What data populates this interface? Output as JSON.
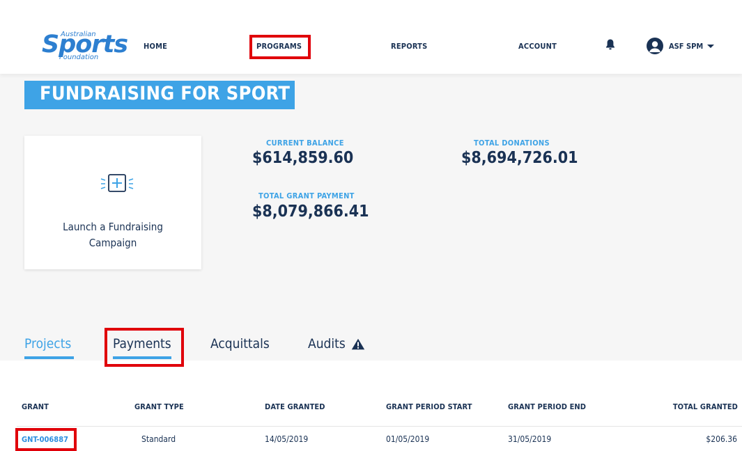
{
  "logo": {
    "top_text": "Australian",
    "main_text": "Sports",
    "bottom_text": "Foundation"
  },
  "nav": {
    "home": "HOME",
    "programs": "PROGRAMS",
    "reports": "REPORTS",
    "account": "ACCOUNT"
  },
  "user": {
    "name": "ASF SPM"
  },
  "page_title": "FUNDRAISING FOR SPORT",
  "launch_card": {
    "line1": "Launch a Fundraising",
    "line2": "Campaign"
  },
  "stats": {
    "current_balance_label": "CURRENT BALANCE",
    "current_balance_value": "$614,859.60",
    "total_donations_label": "TOTAL DONATIONS",
    "total_donations_value": "$8,694,726.01",
    "total_grant_payment_label": "TOTAL GRANT PAYMENT",
    "total_grant_payment_value": "$8,079,866.41"
  },
  "tabs": [
    {
      "label": "Projects"
    },
    {
      "label": "Payments"
    },
    {
      "label": "Acquittals"
    },
    {
      "label": "Audits"
    }
  ],
  "table": {
    "columns": [
      "GRANT",
      "GRANT TYPE",
      "DATE GRANTED",
      "GRANT PERIOD START",
      "GRANT PERIOD END",
      "TOTAL GRANTED"
    ],
    "rows": [
      {
        "grant": "GNT-006887",
        "grant_type": "Standard",
        "date_granted": "14/05/2019",
        "period_start": "01/05/2019",
        "period_end": "31/05/2019",
        "total_granted": "$206.36"
      }
    ]
  },
  "colors": {
    "brand_blue": "#3ea3e6",
    "navy": "#1a3254",
    "highlight_red": "#e0000a"
  },
  "icons": {
    "bell": "bell-icon",
    "avatar": "user-avatar-icon",
    "launch": "add-campaign-icon",
    "audits_warning": "warning-icon"
  }
}
